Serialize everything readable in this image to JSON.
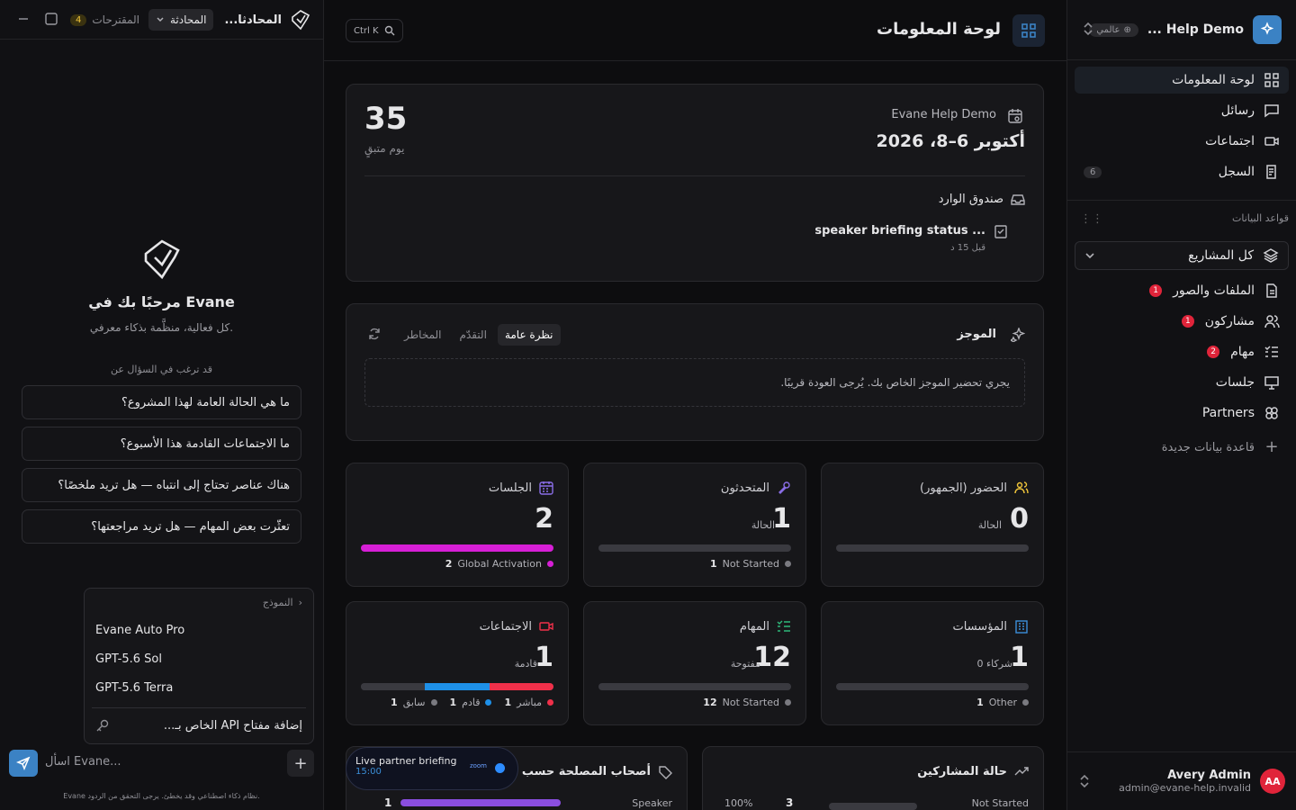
{
  "workspace": {
    "name": "Help Demo ...",
    "badge": "عالمي"
  },
  "nav": [
    {
      "label": "لوحة المعلومات",
      "icon": "dashboard-icon"
    },
    {
      "label": "رسائل",
      "icon": "message-icon"
    },
    {
      "label": "اجتماعات",
      "icon": "video-icon"
    },
    {
      "label": "السجل",
      "icon": "log-icon",
      "count": "6"
    }
  ],
  "databases": {
    "title": "قواعد البيانات",
    "project": "كل المشاريع",
    "items": [
      {
        "label": "الملفات والصور",
        "badge": "1"
      },
      {
        "label": "مشاركون",
        "badge": "1"
      },
      {
        "label": "مهام",
        "badge": "2"
      },
      {
        "label": "جلسات",
        "badge": ""
      },
      {
        "label": "Partners",
        "badge": ""
      }
    ],
    "new": "قاعدة بيانات جديدة"
  },
  "user": {
    "initials": "AA",
    "name": "Avery Admin",
    "email": "admin@evane-help.invalid"
  },
  "header": {
    "title": "لوحة المعلومات",
    "shortcut": "Ctrl K"
  },
  "hero": {
    "days": "35",
    "days_label": "يوم متبقٍ",
    "event": "Evane Help Demo",
    "date": "أكتوبر 6–8، 2026",
    "inbox": "صندوق الوارد",
    "message": "speaker briefing status ...",
    "message_time": "قبل 15 د"
  },
  "briefing": {
    "title": "الموجز",
    "tabs": [
      "نظرة عامة",
      "التقدّم",
      "المخاطر"
    ],
    "text": "يجري تحضير الموجز الخاص بك. يُرجى العودة قريبًا."
  },
  "stats": {
    "attendance": {
      "title": "الحضور (الجمهور)",
      "num": "0",
      "num_label": "الحالة"
    },
    "speakers": {
      "title": "المتحدثون",
      "num": "1",
      "num_label": "الحالة",
      "legend": [
        {
          "count": "1",
          "label": "Not Started"
        }
      ]
    },
    "sessions": {
      "title": "الجلسات",
      "num": "2",
      "legend": [
        {
          "count": "2",
          "label": "Global Activation"
        }
      ]
    },
    "orgs": {
      "title": "المؤسسات",
      "num": "1",
      "num_label": "0 شركاء",
      "legend": [
        {
          "count": "1",
          "label": "Other"
        }
      ]
    },
    "tasks": {
      "title": "المهام",
      "num": "12",
      "num_label": "مفتوحة",
      "legend": [
        {
          "count": "12",
          "label": "Not Started"
        }
      ]
    },
    "meetings": {
      "title": "الاجتماعات",
      "num": "1",
      "num_label": "قادمة",
      "legend": [
        {
          "count": "1",
          "label": "مباشر"
        },
        {
          "count": "1",
          "label": "قادم"
        },
        {
          "count": "1",
          "label": "سابق"
        }
      ]
    }
  },
  "bottom": {
    "participants": {
      "title": "حالة المشاركين",
      "label": "Not Started",
      "count": "3",
      "pct": "100%"
    },
    "stakeholders": {
      "title": "أصحاب المصلحة حسب الـ",
      "label": "Speaker",
      "count": "1"
    }
  },
  "live": {
    "title": "Live partner briefing",
    "time": "15:00",
    "brand": "zoom"
  },
  "chat": {
    "title": "المحادثا...",
    "mode": "المحادثة",
    "suggestions_label": "المقترحات",
    "suggestions_count": "4",
    "welcome": "مرحبًا بك في Evane",
    "welcome_sub": "كل فعالية، منظَّمة بذكاء معرفي.",
    "ask_title": "قد ترغب في السؤال عن",
    "suggestions": [
      "ما هي الحالة العامة لهذا المشروع؟",
      "ما الاجتماعات القادمة هذا الأسبوع؟",
      "هناك عناصر تحتاج إلى انتباه — هل تريد ملخصًا؟",
      "تعثّرت بعض المهام — هل تريد مراجعتها؟"
    ],
    "model_header": "النموذج",
    "models": [
      "Evane Auto Pro",
      "GPT-5.6 Sol",
      "GPT-5.6 Terra"
    ],
    "api": "إضافة مفتاح API الخاص بـ...",
    "placeholder": "اسأل Evane...",
    "disclaimer": "Evane نظام ذكاء اصطناعي وقد يخطئ. يرجى التحقق من الردود."
  },
  "colors": {
    "accent": "#3b82c4",
    "danger": "#e0243a",
    "sessions": "#d61fd6",
    "meeting_live": "#f0304a",
    "meeting_upcoming": "#1e90e8",
    "stakeholders": "#8a4ee0"
  }
}
